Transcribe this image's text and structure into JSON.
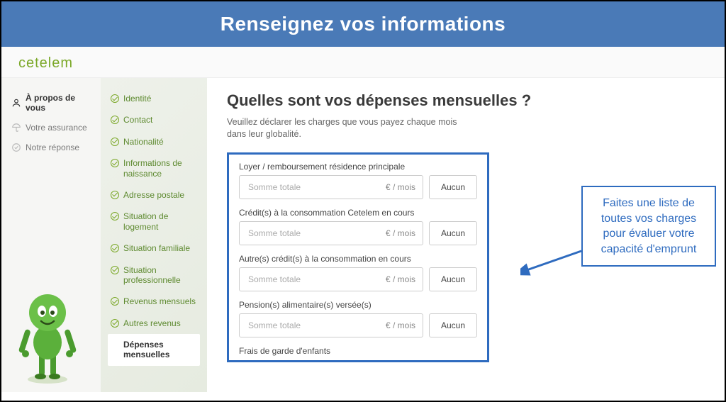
{
  "banner": {
    "title": "Renseignez vos informations"
  },
  "brand": {
    "logo": "cetelem"
  },
  "nav": {
    "items": [
      {
        "label": "À propos de vous",
        "active": true
      },
      {
        "label": "Votre assurance",
        "active": false
      },
      {
        "label": "Notre réponse",
        "active": false
      }
    ]
  },
  "steps": [
    {
      "label": "Identité",
      "done": true
    },
    {
      "label": "Contact",
      "done": true
    },
    {
      "label": "Nationalité",
      "done": true
    },
    {
      "label": "Informations de naissance",
      "done": true
    },
    {
      "label": "Adresse postale",
      "done": true
    },
    {
      "label": "Situation de logement",
      "done": true
    },
    {
      "label": "Situation familiale",
      "done": true
    },
    {
      "label": "Situation professionnelle",
      "done": true
    },
    {
      "label": "Revenus mensuels",
      "done": true
    },
    {
      "label": "Autres revenus",
      "done": true
    },
    {
      "label": "Dépenses mensuelles",
      "done": false,
      "current": true
    }
  ],
  "main": {
    "title": "Quelles sont vos dépenses mensuelles ?",
    "subtitle": "Veuillez déclarer les charges que vous payez chaque mois dans leur globalité.",
    "placeholder": "Somme totale",
    "unit": "€ / mois",
    "none_label": "Aucun",
    "fields": [
      {
        "label": "Loyer / remboursement résidence principale"
      },
      {
        "label": "Crédit(s) à la consommation Cetelem en cours"
      },
      {
        "label": "Autre(s) crédit(s) à la consommation en cours"
      },
      {
        "label": "Pension(s) alimentaire(s) versée(s)"
      }
    ],
    "truncated_next": "Frais de garde d'enfants"
  },
  "callout": {
    "text": "Faites une liste de toutes vos charges pour évaluer votre capacité d'emprunt"
  }
}
